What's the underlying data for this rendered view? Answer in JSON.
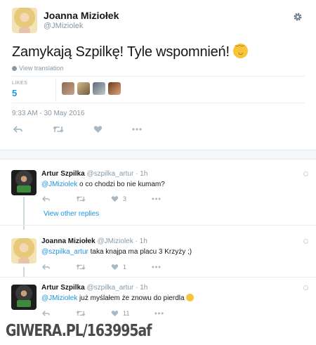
{
  "main_tweet": {
    "author_name": "Joanna Miziołek",
    "author_handle": "@JMiziolek",
    "text": "Zamykają Szpilkę! Tyle wspomnień! ",
    "emoji": "relieved-face-emoji",
    "translate_label": "View translation",
    "likes_label": "LIKES",
    "likes_count": "5",
    "likers": [
      "liker-avatar-1",
      "liker-avatar-2",
      "liker-avatar-3",
      "liker-avatar-4"
    ],
    "timestamp": "9:33 AM - 30 May 2016"
  },
  "replies": [
    {
      "author_name": "Artur Szpilka",
      "author_handle": "@szpilka_artur",
      "time": "· 1h",
      "mention": "@JMiziolek",
      "text": " o co chodzi bo nie kumam?",
      "likes": "3"
    },
    {
      "author_name": "Joanna Miziołek",
      "author_handle": "@JMiziolek",
      "time": "· 1h",
      "mention": "@szpilka_artur",
      "text": " taka knajpa ma placu 3 Krzyży ;)",
      "likes": "1"
    },
    {
      "author_name": "Artur Szpilka",
      "author_handle": "@szpilka_artur",
      "time": "· 1h",
      "mention": "@JMiziolek",
      "text": " już myślałem że znowu do pierdla",
      "likes": "11"
    }
  ],
  "view_other_replies": "View other replies",
  "watermark": "GIWERA.PL/163995af",
  "colors": {
    "link_blue": "#1b95e0",
    "muted": "#8899a6",
    "icon_gray": "#aab8c2"
  }
}
